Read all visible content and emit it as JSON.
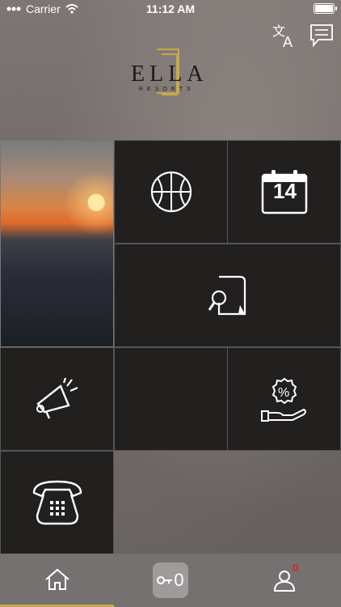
{
  "status_bar": {
    "carrier": "Carrier",
    "time": "11:12 AM"
  },
  "header": {
    "logo_text": "ELLA",
    "logo_subtext": "RESORTS",
    "icons": [
      "translate-icon",
      "chat-icon"
    ]
  },
  "tiles": {
    "sports": {
      "icon": "basketball-icon"
    },
    "calendar": {
      "icon": "calendar-icon",
      "day": "14"
    },
    "search": {
      "icon": "document-search-icon"
    },
    "announcements": {
      "icon": "megaphone-icon"
    },
    "offers": {
      "icon": "discount-hand-icon"
    },
    "phone": {
      "icon": "telephone-icon"
    }
  },
  "tabbar": {
    "home": {
      "icon": "home-icon"
    },
    "key": {
      "icon": "key-icon",
      "count": "0"
    },
    "profile": {
      "icon": "user-icon",
      "badge": "0"
    }
  },
  "colors": {
    "accent": "#c9a84a",
    "tile": "#221f1f",
    "badge": "#e81c1c"
  }
}
